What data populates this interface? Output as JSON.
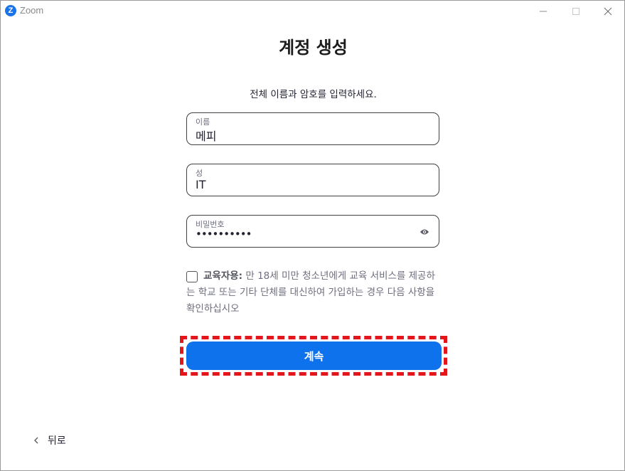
{
  "window": {
    "app_title": "Zoom",
    "logo_letter": "Z"
  },
  "page": {
    "title": "계정 생성",
    "subtitle": "전체 이름과 암호를 입력하세요."
  },
  "fields": {
    "first_name": {
      "label": "이름",
      "value": "메피"
    },
    "last_name": {
      "label": "성",
      "value": "IT"
    },
    "password": {
      "label": "비밀번호",
      "value": "••••••••••"
    }
  },
  "education": {
    "bold_label": "교육자용:",
    "description": " 만 18세 미만 청소년에게 교육 서비스를 제공하는 학교 또는 기타 단체를 대신하여 가입하는 경우 다음 사항을 확인하십시오",
    "checked": false
  },
  "actions": {
    "continue_label": "계속",
    "back_label": "뒤로"
  },
  "colors": {
    "accent": "#0e72ed",
    "highlight": "#e4151b"
  },
  "icons": {
    "logo": "zoom-logo-icon",
    "minimize": "minimize-icon",
    "maximize": "maximize-icon",
    "close": "close-icon",
    "show_password": "eye-icon",
    "back": "chevron-left-icon"
  }
}
